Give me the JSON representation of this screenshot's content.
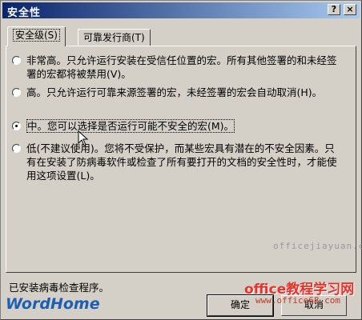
{
  "window": {
    "title": "安全性"
  },
  "titlebar": {
    "help_label": "?",
    "close_label": "×"
  },
  "tabs": [
    {
      "label": "安全级(S)"
    },
    {
      "label": "可靠发行商(T)"
    }
  ],
  "options": [
    {
      "text": "非常高。只允许运行安装在受信任位置的宏。所有其他签署的和未经签署的宏都将被禁用(V)。",
      "checked": false
    },
    {
      "text": "高。只允许运行可靠来源签署的宏，未经签署的宏会自动取消(H)。",
      "checked": false
    },
    {
      "text": "中。您可以选择是否运行可能不安全的宏(M)。",
      "checked": true
    },
    {
      "text": "低(不建议使用)。您将不受保护，而某些宏具有潜在的不安全因素。只有在安装了防病毒软件或检查了所有要打开的文档的安全性时，才能使用这项设置(L)。",
      "checked": false
    }
  ],
  "status": {
    "text": "已安装病毒检查程序。"
  },
  "buttons": {
    "ok_label": "确定",
    "cancel_label": "取消"
  },
  "watermarks": {
    "site_url": "officejiayuan.com",
    "site_cn": "office教程学习网",
    "site_url2": "www.office68.com",
    "logo": "WordHome"
  }
}
